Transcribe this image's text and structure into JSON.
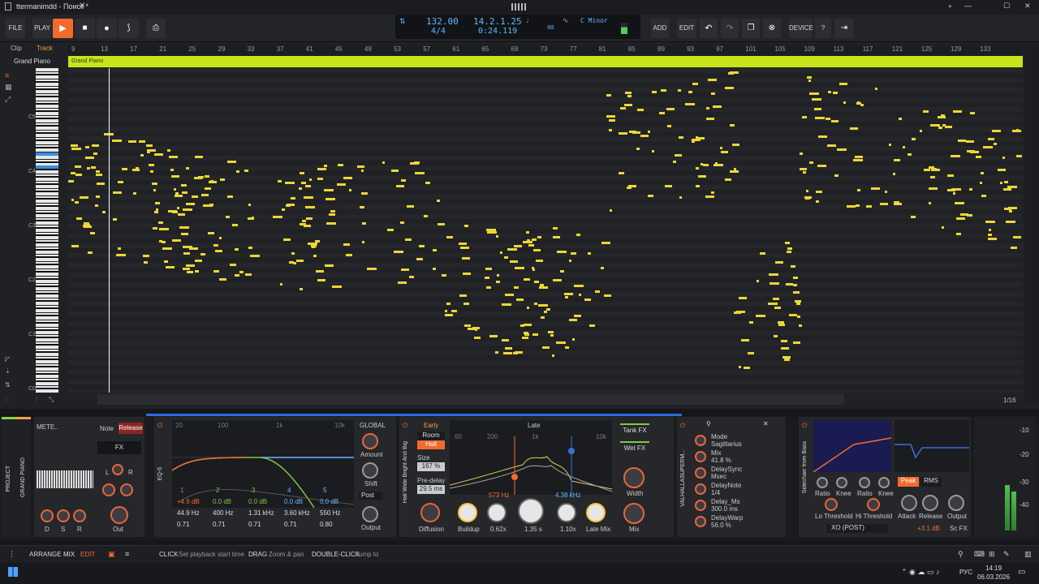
{
  "window": {
    "title": "ttermanimdd - Поиск *",
    "minimize": "—",
    "maximize": "☐",
    "close": "✕"
  },
  "toolbar": {
    "file": "FILE",
    "play_label": "PLAY",
    "add": "ADD",
    "edit": "EDIT",
    "device": "DEVICE",
    "help": "?"
  },
  "transport": {
    "tempo": "132.00",
    "signature": "4/4",
    "position": "14.2.1.25",
    "time": "0:24.119",
    "key": "C Minor"
  },
  "tracks": {
    "clip_tab": "Clip",
    "track_tab": "Track",
    "track_name": "Grand Piano"
  },
  "clip": {
    "name": "Grand Piano"
  },
  "ruler": {
    "labels": [
      "9",
      "13",
      "17",
      "21",
      "25",
      "29",
      "33",
      "37",
      "41",
      "45",
      "49",
      "53",
      "57",
      "61",
      "65",
      "69",
      "73",
      "77",
      "81",
      "85",
      "89",
      "93",
      "97",
      "101",
      "105",
      "109",
      "113",
      "117",
      "121",
      "125",
      "129",
      "133"
    ]
  },
  "keys": {
    "labels": [
      "C5",
      "C4",
      "C3",
      "C2",
      "C1",
      "C0"
    ]
  },
  "zoom": {
    "value": "1/16"
  },
  "devices": {
    "project": "PROJECT",
    "grand_piano": "GRAND PIANO",
    "note_tab": "Note",
    "release_tab": "Release",
    "fx_tab": "FX",
    "meter": "METE..",
    "lr": [
      "L",
      "R"
    ],
    "dsr": [
      "D",
      "S",
      "R"
    ],
    "out": "Out",
    "eq_name": "EQ-5",
    "eq_freqs": [
      "20",
      "100",
      "1k",
      "10k"
    ],
    "eq_bands": [
      {
        "num": "1",
        "gain": "+4.6 dB",
        "freq": "44.9 Hz",
        "q": "0.71"
      },
      {
        "num": "2",
        "gain": "0.0 dB",
        "freq": "400 Hz",
        "q": "0.71"
      },
      {
        "num": "3",
        "gain": "0.0 dB",
        "freq": "1.31 kHz",
        "q": "0.71"
      },
      {
        "num": "4",
        "gain": "0.0 dB",
        "freq": "3.60 kHz",
        "q": "0.71"
      },
      {
        "num": "5",
        "gain": "0.0 dB",
        "freq": "550 Hz",
        "q": "0.80"
      }
    ],
    "global": "GLOBAL",
    "amount": "Amount",
    "shift": "Shift",
    "post": "Post",
    "output": "Output",
    "reverb_name": "Hall Wide Bright And Big",
    "early": "Early",
    "room": "Room",
    "hall": "Hall",
    "size": "Size",
    "size_val": "167 %",
    "predelay": "Pre-delay",
    "predelay_val": "29.5 ms",
    "diffusion": "Diffusion",
    "late": "Late",
    "late_freqs": [
      "60",
      "200",
      "1k",
      "10k"
    ],
    "low_freq": "573 Hz",
    "high_freq": "4.38 kHz",
    "buildup": "Buildup",
    "v062": "0.62x",
    "v135": "1.35 s",
    "v110": "1.10x",
    "late_mix": "Late Mix",
    "tank_fx": "Tank FX",
    "wet_fx": "Wet FX",
    "width": "Width",
    "mix": "Mix",
    "valhalla_name": "VALHALLASUPERM...",
    "params": [
      {
        "name": "Mode",
        "value": "Sagittarius"
      },
      {
        "name": "Mix",
        "value": "41.8 %"
      },
      {
        "name": "DelaySync",
        "value": "Msec"
      },
      {
        "name": "DelayNote",
        "value": "1/4"
      },
      {
        "name": "Delay_Ms",
        "value": "300.0 ms"
      },
      {
        "name": "DelayWarp",
        "value": "56.0 %"
      }
    ],
    "sidechain_name": "Sidechain from Bass",
    "ratio": "Ratio",
    "knee": "Knee",
    "lo_threshold": "Lo Threshold",
    "hi_threshold": "Hi Threshold",
    "peak": "Peak",
    "rms": "RMS",
    "attack": "Attack",
    "release": "Release",
    "comp_output": "Output",
    "sc_source": "XO (POST)",
    "gain_val": "+3.1 dB",
    "sc_fx": "Sc FX",
    "meter_scale": [
      "-10",
      "-20",
      "-30",
      "-40"
    ]
  },
  "status": {
    "arrange": "ARRANGE",
    "mix": "MIX",
    "edit": "EDIT",
    "click": "CLICK",
    "click_desc": "Set playback start time",
    "drag": "DRAG",
    "drag_desc": "Zoom & pan",
    "dbl": "DOUBLE-CLICK",
    "dbl_desc": "Jump to"
  },
  "taskbar": {
    "lang": "РУС",
    "time": "14:19",
    "date": "06.03.2026"
  },
  "colors": {
    "accent": "#f26b2c",
    "note": "#ecd735",
    "clip": "#c8e51b",
    "blue": "#62b8ff"
  }
}
